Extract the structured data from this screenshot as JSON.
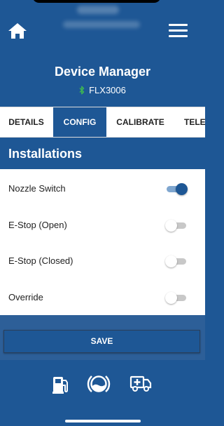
{
  "header": {
    "title": "Device Manager",
    "device_id": "FLX3006",
    "icons": {
      "home": "home-icon",
      "menu": "hamburger-menu-icon",
      "connection": "bluetooth-icon"
    }
  },
  "tabs": [
    {
      "label": "DETAILS",
      "active": false
    },
    {
      "label": "CONFIG",
      "active": true
    },
    {
      "label": "CALIBRATE",
      "active": false
    },
    {
      "label": "TELE",
      "active": false
    }
  ],
  "section": {
    "title": "Installations"
  },
  "settings": [
    {
      "label": "Nozzle Switch",
      "enabled": true
    },
    {
      "label": "E-Stop (Open)",
      "enabled": false
    },
    {
      "label": "E-Stop (Closed)",
      "enabled": false
    },
    {
      "label": "Override",
      "enabled": false
    }
  ],
  "save_label": "SAVE",
  "bottom_nav": [
    {
      "icon": "fuel-pump-icon"
    },
    {
      "icon": "tank-gauge-icon"
    },
    {
      "icon": "service-truck-icon"
    }
  ],
  "colors": {
    "primary": "#1e5795",
    "toggle_on": "#1e5795",
    "toggle_off": "#c8c8c8"
  }
}
